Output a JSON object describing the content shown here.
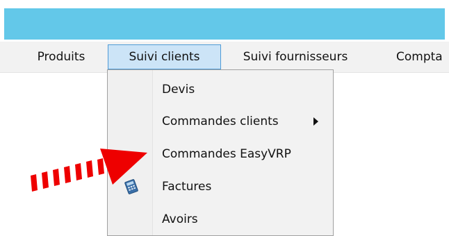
{
  "menu_bar": {
    "items": [
      {
        "label": "Produits",
        "active": false
      },
      {
        "label": "Suivi clients",
        "active": true
      },
      {
        "label": "Suivi fournisseurs",
        "active": false
      },
      {
        "label": "Compta",
        "active": false
      }
    ]
  },
  "dropdown": {
    "items": [
      {
        "label": "Devis",
        "icon": ""
      },
      {
        "label": "Commandes clients",
        "has_submenu": true
      },
      {
        "label": "Commandes EasyVRP"
      },
      {
        "label": "Factures",
        "icon": "calculator-icon"
      },
      {
        "label": "Avoirs"
      }
    ]
  },
  "colors": {
    "title_strip": "#63c8e9",
    "menu_highlight": "#cce4f7",
    "menu_highlight_border": "#4f9bd6",
    "annotation_arrow": "#ee0000"
  }
}
